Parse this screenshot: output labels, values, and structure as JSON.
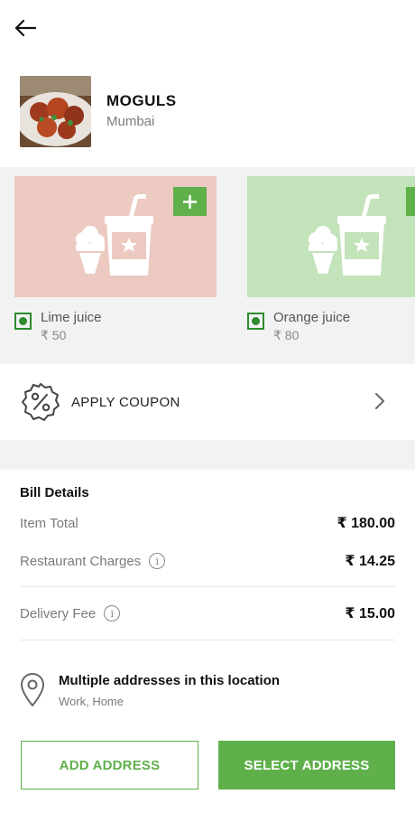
{
  "header": {
    "back_icon": "arrow-left-icon"
  },
  "restaurant": {
    "name": "MOGULS",
    "city": "Mumbai"
  },
  "recommendations": [
    {
      "name": "Lime juice",
      "price": "₹ 50",
      "bg": "#ecc9c1",
      "icon": "drink-and-icecream-icon"
    },
    {
      "name": "Orange juice",
      "price": "₹ 80",
      "bg": "#c3e3bb",
      "icon": "drink-and-icecream-icon"
    }
  ],
  "coupon": {
    "label": "APPLY COUPON",
    "icon": "discount-badge-icon"
  },
  "bill": {
    "title": "Bill Details",
    "rows": [
      {
        "label": "Item Total",
        "value": "₹ 180.00"
      },
      {
        "label": "Restaurant Charges",
        "value": "₹ 14.25"
      },
      {
        "label": "Delivery Fee",
        "value": "₹ 15.00"
      }
    ]
  },
  "address": {
    "title": "Multiple addresses in this location",
    "subtitle": "Work, Home"
  },
  "buttons": {
    "add": "ADD ADDRESS",
    "select": "SELECT ADDRESS"
  },
  "colors": {
    "accent": "#5fb04b",
    "veg": "#2e8b2e",
    "section_bg": "#f2f2f2"
  }
}
